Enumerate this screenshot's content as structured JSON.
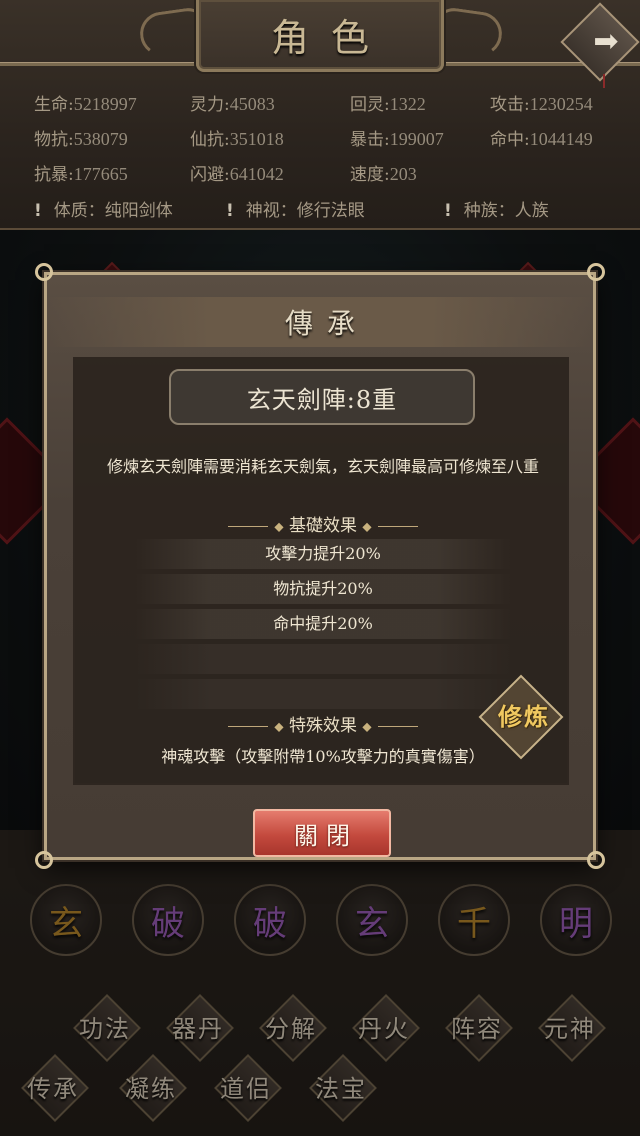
{
  "header": {
    "title": "角色",
    "back_icon": "arrow-right-icon"
  },
  "stats": [
    {
      "label": "生命:",
      "value": "5218997"
    },
    {
      "label": "灵力:",
      "value": "45083"
    },
    {
      "label": "回灵:",
      "value": "1322"
    },
    {
      "label": "攻击:",
      "value": "1230254"
    },
    {
      "label": "物抗:",
      "value": "538079"
    },
    {
      "label": "仙抗:",
      "value": "351018"
    },
    {
      "label": "暴击:",
      "value": "199007"
    },
    {
      "label": "命中:",
      "value": "1044149"
    },
    {
      "label": "抗暴:",
      "value": "177665"
    },
    {
      "label": "闪避:",
      "value": "641042"
    },
    {
      "label": "速度:",
      "value": "203"
    }
  ],
  "traits": [
    {
      "icon": "!",
      "text": "体质：纯阳剑体"
    },
    {
      "icon": "!",
      "text": "神视：修行法眼"
    },
    {
      "icon": "!",
      "text": "种族：人族"
    }
  ],
  "modal": {
    "title": "傳承",
    "skill_name": "玄天劍陣:8重",
    "description": "修煉玄天劍陣需要消耗玄天劍氣，玄天劍陣最高可修煉至八重",
    "base_heading": "基礎效果",
    "base_effects": [
      "攻擊力提升20%",
      "物抗提升20%",
      "命中提升20%"
    ],
    "special_heading": "特殊效果",
    "special_effect": "神魂攻擊（攻擊附帶10%攻擊力的真實傷害）",
    "cultivate_label": "修炼",
    "close_label": "關閉",
    "diamond_glyph": "◆"
  },
  "orbs": [
    {
      "char": "玄",
      "color": "gold"
    },
    {
      "char": "破",
      "color": "purple"
    },
    {
      "char": "破",
      "color": "purple"
    },
    {
      "char": "玄",
      "color": "purple"
    },
    {
      "char": "千",
      "color": "gold"
    },
    {
      "char": "明",
      "color": "purple"
    }
  ],
  "menu_row1": [
    "功法",
    "器丹",
    "分解",
    "丹火",
    "阵容",
    "元神"
  ],
  "menu_row2": [
    "传承",
    "凝练",
    "道侣",
    "法宝"
  ],
  "colors": {
    "accent_gold": "#f0c860",
    "close_red": "#c44a3e",
    "orb_gold": "#b8872c",
    "orb_purple": "#9b5cb8"
  }
}
